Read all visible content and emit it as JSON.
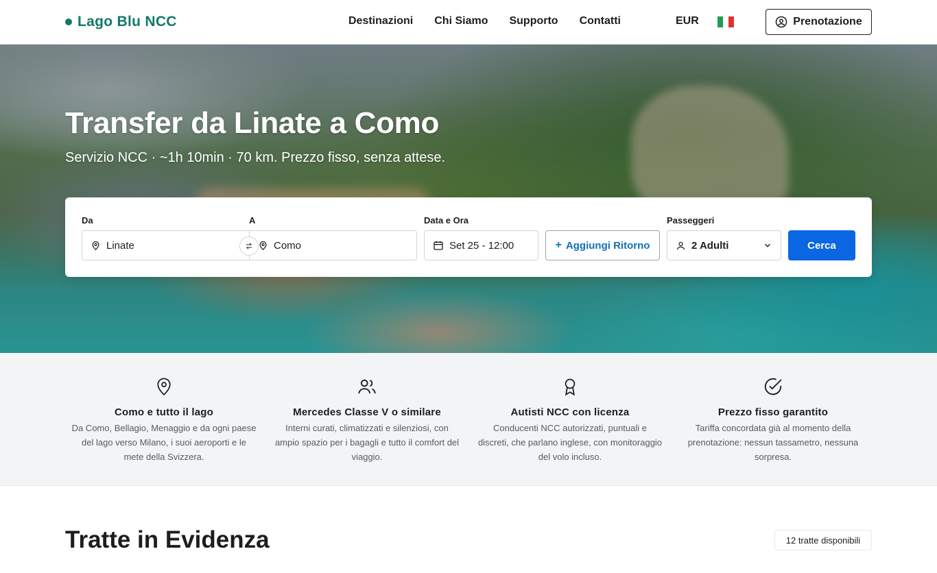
{
  "header": {
    "brand": "Lago Blu NCC",
    "nav": [
      "Destinazioni",
      "Chi Siamo",
      "Supporto",
      "Contatti"
    ],
    "currency": "EUR",
    "language_flag": "italy-flag",
    "booking_label": "Prenotazione"
  },
  "hero": {
    "title": "Transfer da Linate a Como",
    "subtitle": "Servizio NCC · ~1h 10min · 70 km. Prezzo fisso, senza attese."
  },
  "search": {
    "from_label": "Da",
    "from_value": "Linate",
    "to_label": "A",
    "to_value": "Como",
    "date_label": "Data e Ora",
    "date_value": "Set 25 - 12:00",
    "return_label": "Aggiungi Ritorno",
    "passengers_label": "Passeggeri",
    "passengers_value": "2 Adulti",
    "search_button": "Cerca"
  },
  "features": [
    {
      "icon": "map-pin-icon",
      "title": "Como e tutto il lago",
      "text": "Da Como, Bellagio, Menaggio e da ogni paese del lago verso Milano, i suoi aeroporti e le mete della Svizzera."
    },
    {
      "icon": "users-icon",
      "title": "Mercedes Classe V o similare",
      "text": "Interni curati, climatizzati e silenziosi, con ampio spazio per i bagagli e tutto il comfort del viaggio."
    },
    {
      "icon": "award-icon",
      "title": "Autisti NCC con licenza",
      "text": "Conducenti NCC autorizzati, puntuali e discreti, che parlano inglese, con monitoraggio del volo incluso."
    },
    {
      "icon": "check-circle-icon",
      "title": "Prezzo fisso garantito",
      "text": "Tariffa concordata già al momento della prenotazione: nessun tassametro, nessuna sorpresa."
    }
  ],
  "routes": {
    "title": "Tratte in Evidenza",
    "count_badge": "12 tratte disponibili"
  },
  "colors": {
    "brand": "#0f7a6a",
    "primary_button": "#0b66e4",
    "link_accent": "#1170b8"
  }
}
